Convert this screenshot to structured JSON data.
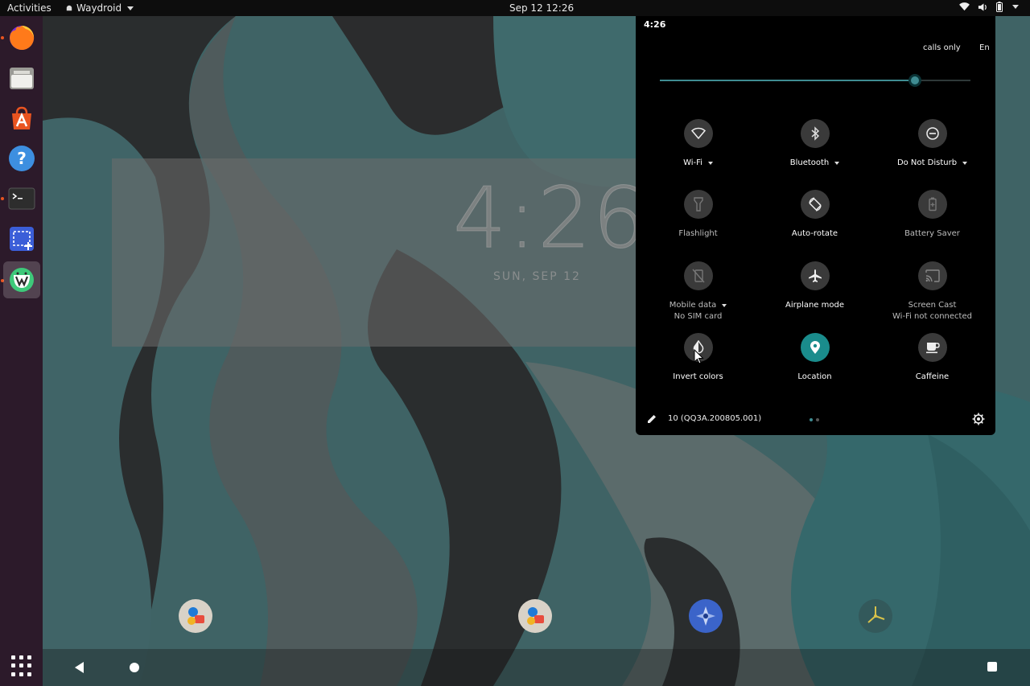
{
  "topbar": {
    "activities": "Activities",
    "app_name": "Waydroid",
    "datetime": "Sep 12  12:26",
    "icons": [
      "wifi-icon",
      "volume-icon",
      "battery-icon",
      "power-menu-icon"
    ]
  },
  "dock": {
    "items": [
      {
        "name": "firefox",
        "icon": "firefox-icon",
        "running": true
      },
      {
        "name": "files",
        "icon": "files-icon",
        "running": false
      },
      {
        "name": "software",
        "icon": "software-center-icon",
        "running": false
      },
      {
        "name": "help",
        "icon": "help-icon",
        "running": false
      },
      {
        "name": "terminal",
        "icon": "terminal-icon",
        "running": true
      },
      {
        "name": "screenshot",
        "icon": "screenshot-icon",
        "running": false
      },
      {
        "name": "waydroid",
        "icon": "waydroid-icon",
        "running": true
      }
    ],
    "app_grid_icon": "show-applications-icon"
  },
  "android": {
    "lock_time": "4:26",
    "lock_date": "SUN, SEP 12",
    "home_icons": [
      "contacts-messaging-icon",
      "contacts-messaging-icon",
      "compass-icon",
      "clock-app-icon"
    ],
    "quick_settings": {
      "status_time": "4:26",
      "carrier_text": "calls only",
      "carrier_text_2": "En",
      "brightness": 0.82,
      "accent": "#3f8c92",
      "tiles": [
        {
          "label": "Wi-Fi",
          "icon": "wifi-icon",
          "dropdown": true,
          "on": false
        },
        {
          "label": "Bluetooth",
          "icon": "bluetooth-icon",
          "dropdown": true,
          "on": false
        },
        {
          "label": "Do Not Disturb",
          "icon": "do-not-disturb-icon",
          "dropdown": true,
          "on": false
        },
        {
          "label": "Flashlight",
          "icon": "flashlight-icon",
          "dropdown": false,
          "on": false,
          "dim": true
        },
        {
          "label": "Auto-rotate",
          "icon": "auto-rotate-icon",
          "dropdown": false,
          "on": false
        },
        {
          "label": "Battery Saver",
          "icon": "battery-saver-icon",
          "dropdown": false,
          "on": false,
          "dim": true
        },
        {
          "label": "Mobile data",
          "sub": "No SIM card",
          "icon": "mobile-data-off-icon",
          "dropdown": true,
          "on": false,
          "dim": true
        },
        {
          "label": "Airplane mode",
          "icon": "airplane-icon",
          "dropdown": false,
          "on": false
        },
        {
          "label": "Screen Cast",
          "sub": "Wi-Fi not connected",
          "icon": "cast-icon",
          "dropdown": false,
          "on": false,
          "dim": true
        },
        {
          "label": "Invert colors",
          "icon": "invert-colors-icon",
          "dropdown": false,
          "on": false
        },
        {
          "label": "Location",
          "icon": "location-icon",
          "dropdown": false,
          "on": true
        },
        {
          "label": "Caffeine",
          "icon": "caffeine-icon",
          "dropdown": false,
          "on": false
        }
      ],
      "build_number": "10 (QQ3A.200805.001)",
      "page_count": 2,
      "current_page": 1
    }
  }
}
